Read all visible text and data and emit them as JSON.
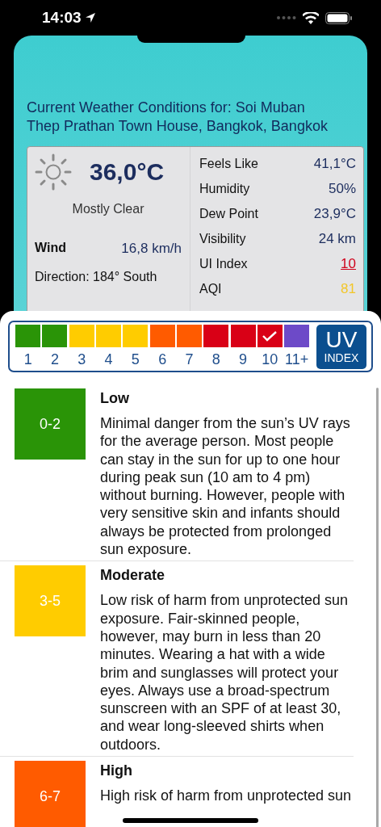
{
  "status_bar": {
    "time": "14:03"
  },
  "title": "Current Weather Conditions for: Soi Muban Thep Prathan Town House, Bangkok, Bangkok",
  "current": {
    "temperature": "36,0°C",
    "condition": "Mostly Clear",
    "wind_label": "Wind",
    "wind_value": "16,8 km/h",
    "direction": "Direction: 184° South"
  },
  "details": [
    {
      "label": "Feels Like",
      "value": "41,1°C",
      "color": "#1c2d5e",
      "underlined": false
    },
    {
      "label": "Humidity",
      "value": "50%",
      "color": "#1c2d5e",
      "underlined": false
    },
    {
      "label": "Dew Point",
      "value": "23,9°C",
      "color": "#1c2d5e",
      "underlined": false
    },
    {
      "label": "Visibility",
      "value": "24 km",
      "color": "#1c2d5e",
      "underlined": false
    },
    {
      "label": "UI Index",
      "value": "10",
      "color": "#d0021b",
      "underlined": true
    },
    {
      "label": "AQI",
      "value": "81",
      "color": "#f2c62a",
      "underlined": false
    }
  ],
  "uv_scale": {
    "levels": [
      {
        "label": "1",
        "color": "#2a9407",
        "selected": false
      },
      {
        "label": "2",
        "color": "#2a9407",
        "selected": false
      },
      {
        "label": "3",
        "color": "#ffcc00",
        "selected": false
      },
      {
        "label": "4",
        "color": "#ffcc00",
        "selected": false
      },
      {
        "label": "5",
        "color": "#ffcc00",
        "selected": false
      },
      {
        "label": "6",
        "color": "#ff5b00",
        "selected": false
      },
      {
        "label": "7",
        "color": "#ff5b00",
        "selected": false
      },
      {
        "label": "8",
        "color": "#d90016",
        "selected": false
      },
      {
        "label": "9",
        "color": "#d90016",
        "selected": false
      },
      {
        "label": "10",
        "color": "#d90016",
        "selected": true
      },
      {
        "label": "11+",
        "color": "#6d4ac8",
        "selected": false
      }
    ],
    "badge_title": "UV",
    "badge_subtitle": "INDEX"
  },
  "categories": [
    {
      "range": "0-2",
      "color": "#2a9407",
      "title": "Low",
      "text": "Minimal danger from the sun’s UV rays for the average person. Most people can stay in the sun for up to one hour during peak sun (10 am to 4 pm) without burning. However, people with very sensitive skin and infants should always be protected from prolonged sun exposure."
    },
    {
      "range": "3-5",
      "color": "#ffcc00",
      "title": "Moderate",
      "text": "Low risk of harm from unprotected sun exposure. Fair-skinned people, however, may burn in less than 20 minutes. Wearing a hat with a wide brim and sunglasses will protect your eyes. Always use a broad-spectrum sunscreen with an SPF of at least 30, and wear long-sleeved shirts when outdoors."
    },
    {
      "range": "6-7",
      "color": "#ff5b00",
      "title": "High",
      "text": "High risk of harm from unprotected sun"
    }
  ]
}
